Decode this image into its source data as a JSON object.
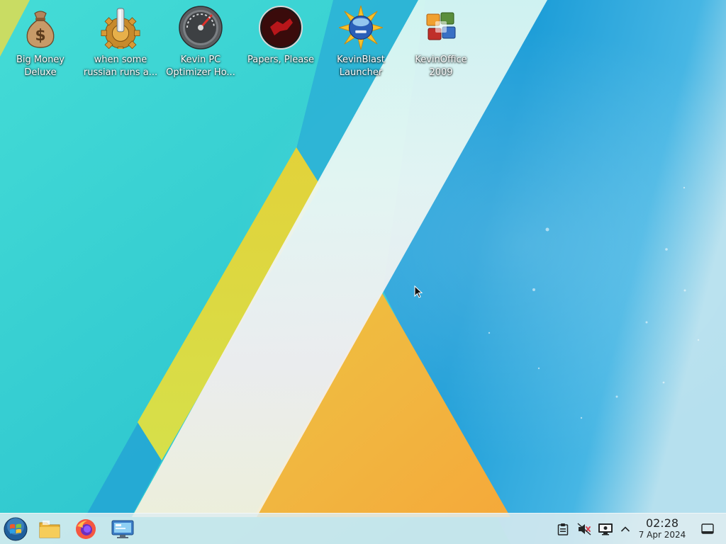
{
  "desktop": {
    "icons": [
      {
        "line1": "Big Money",
        "line2": "Deluxe",
        "icon": "money-bag-icon"
      },
      {
        "line1": "when some",
        "line2": "russian runs a...",
        "icon": "gear-joystick-icon"
      },
      {
        "line1": "Kevin PC",
        "line2": "Optimizer Ho...",
        "icon": "speedometer-icon"
      },
      {
        "line1": "Papers, Please",
        "line2": "",
        "icon": "papers-please-icon"
      },
      {
        "line1": "KevinBlast",
        "line2": "Launcher",
        "icon": "burst-disc-icon"
      },
      {
        "line1": "KevinOffice",
        "line2": "2009",
        "icon": "office-logo-icon"
      }
    ]
  },
  "taskbar": {
    "launchers": [
      {
        "name": "start-menu",
        "icon": "windows-orb-icon"
      },
      {
        "name": "file-manager",
        "icon": "folder-icon"
      },
      {
        "name": "firefox",
        "icon": "firefox-icon"
      },
      {
        "name": "remote-desktop",
        "icon": "monitor-icon"
      }
    ],
    "tray": {
      "icons": [
        "clipboard-icon",
        "volume-muted-icon",
        "display-icon",
        "chevron-up-icon",
        "show-desktop-icon"
      ]
    },
    "clock": {
      "time": "02:28",
      "date": "7 Apr 2024"
    }
  },
  "colors": {
    "taskbar_bg": "#dcecf0",
    "wallpaper_teal": "#2cc4d4",
    "wallpaper_blue": "#1fa4d6",
    "wallpaper_yellow": "#e3d83a",
    "wallpaper_orange": "#f0b03c"
  }
}
